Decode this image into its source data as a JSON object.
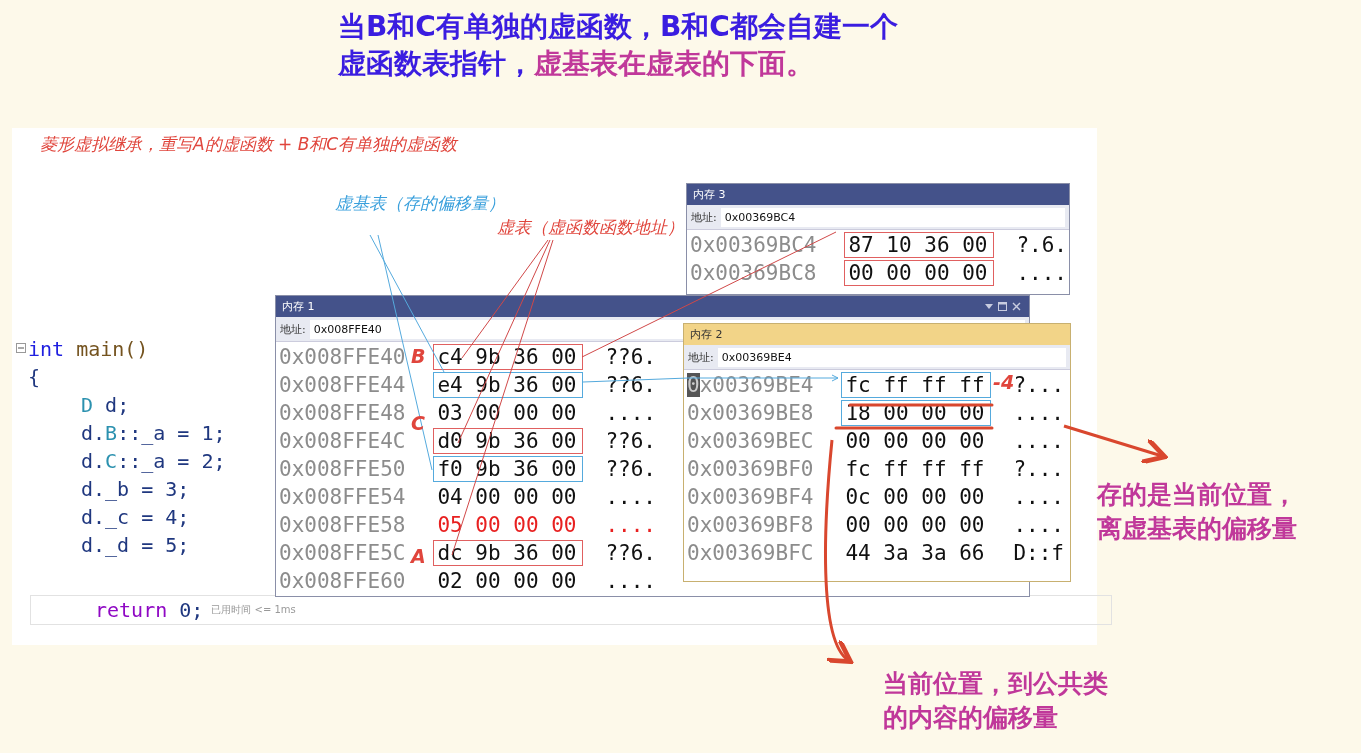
{
  "heading": [
    {
      "text": "当B和C有单独的虚函数，B和C都会自建一个虚函数表指针，",
      "emphasis": false
    },
    {
      "text": "虚基表在虚表的下面。",
      "emphasis": true
    }
  ],
  "slide_title": "菱形虚拟继承，重写A的虚函数 + B和C有单独的虚函数",
  "labels": [
    {
      "text": "虚基表（存的偏移量）",
      "kind": "vbtable"
    },
    {
      "text": "虚表（虚函数函数地址）",
      "kind": "vtable"
    }
  ],
  "code": {
    "lines": [
      {
        "tokens": [
          {
            "text": "int",
            "kind": "keyword"
          },
          {
            "text": " main()",
            "kind": "function"
          }
        ],
        "fold": true
      },
      {
        "tokens": [
          {
            "text": "{",
            "kind": "plain"
          }
        ],
        "children": [
          {
            "tokens": [
              {
                "text": "D",
                "kind": "type"
              },
              {
                "text": " d;",
                "kind": "plain"
              }
            ]
          },
          {
            "tokens": [
              {
                "text": "d.",
                "kind": "plain"
              },
              {
                "text": "B",
                "kind": "type"
              },
              {
                "text": "::_a = 1;",
                "kind": "plain"
              }
            ]
          },
          {
            "tokens": [
              {
                "text": "d.",
                "kind": "plain"
              },
              {
                "text": "C",
                "kind": "type"
              },
              {
                "text": "::_a = 2;",
                "kind": "plain"
              }
            ]
          },
          {
            "tokens": [
              {
                "text": "d._b = 3;",
                "kind": "plain"
              }
            ]
          },
          {
            "tokens": [
              {
                "text": "d._c = 4;",
                "kind": "plain"
              }
            ]
          },
          {
            "tokens": [
              {
                "text": "d._d = 5;",
                "kind": "plain"
              }
            ]
          },
          {
            "tokens": [
              {
                "text": "return",
                "kind": "control"
              },
              {
                "text": " 0;",
                "kind": "plain"
              }
            ],
            "current": true,
            "hint": "已用时间 <= 1ms"
          }
        ]
      }
    ]
  },
  "memory_windows": [
    {
      "title": "内存 3",
      "active": false,
      "address_label": "地址:",
      "address": "0x00369BC4",
      "rows": [
        {
          "address": "0x00369BC4",
          "bytes": "87 10 36 00",
          "ascii": "?.6.",
          "kind": "vtable"
        },
        {
          "address": "0x00369BC8",
          "bytes": "00 00 00 00",
          "ascii": "....",
          "kind": "vtable"
        }
      ]
    },
    {
      "title": "内存 1",
      "active": false,
      "controls": true,
      "address_label": "地址:",
      "address": "0x008FFE40",
      "rows": [
        {
          "address": "0x008FFE40",
          "bytes": "c4 9b 36 00",
          "ascii": "??6.",
          "kind": "vtable",
          "changed": false
        },
        {
          "address": "0x008FFE44",
          "bytes": "e4 9b 36 00",
          "ascii": "??6.",
          "kind": "vbtable",
          "changed": false
        },
        {
          "address": "0x008FFE48",
          "bytes": "03 00 00 00",
          "ascii": "....",
          "changed": false
        },
        {
          "address": "0x008FFE4C",
          "bytes": "d0 9b 36 00",
          "ascii": "??6.",
          "kind": "vtable",
          "changed": false
        },
        {
          "address": "0x008FFE50",
          "bytes": "f0 9b 36 00",
          "ascii": "??6.",
          "kind": "vbtable",
          "changed": false
        },
        {
          "address": "0x008FFE54",
          "bytes": "04 00 00 00",
          "ascii": "....",
          "changed": false
        },
        {
          "address": "0x008FFE58",
          "bytes": "05 00 00 00",
          "ascii": "....",
          "changed": true
        },
        {
          "address": "0x008FFE5C",
          "bytes": "dc 9b 36 00",
          "ascii": "??6.",
          "kind": "vtable",
          "changed": false
        },
        {
          "address": "0x008FFE60",
          "bytes": "02 00 00 00",
          "ascii": "....",
          "changed": false
        }
      ]
    },
    {
      "title": "内存 2",
      "active": true,
      "address_label": "地址:",
      "address": "0x00369BE4",
      "rows": [
        {
          "address": "0x00369BE4",
          "bytes": "fc ff ff ff",
          "ascii": "?...",
          "kind": "vbtable",
          "caret": true
        },
        {
          "address": "0x00369BE8",
          "bytes": "18 00 00 00",
          "ascii": "....",
          "kind": "vbtable"
        },
        {
          "address": "0x00369BEC",
          "bytes": "00 00 00 00",
          "ascii": "...."
        },
        {
          "address": "0x00369BF0",
          "bytes": "fc ff ff ff",
          "ascii": "?..."
        },
        {
          "address": "0x00369BF4",
          "bytes": "0c 00 00 00",
          "ascii": "...."
        },
        {
          "address": "0x00369BF8",
          "bytes": "00 00 00 00",
          "ascii": "...."
        },
        {
          "address": "0x00369BFC",
          "bytes": "44 3a 3a 66",
          "ascii": "D::f"
        }
      ]
    }
  ],
  "object_markers": [
    "B",
    "C",
    "A"
  ],
  "offset_marker": "-4",
  "notes": [
    "存的是当前位置，离虚基表的偏移量",
    "当前位置，到公共类的内容的偏移量"
  ]
}
